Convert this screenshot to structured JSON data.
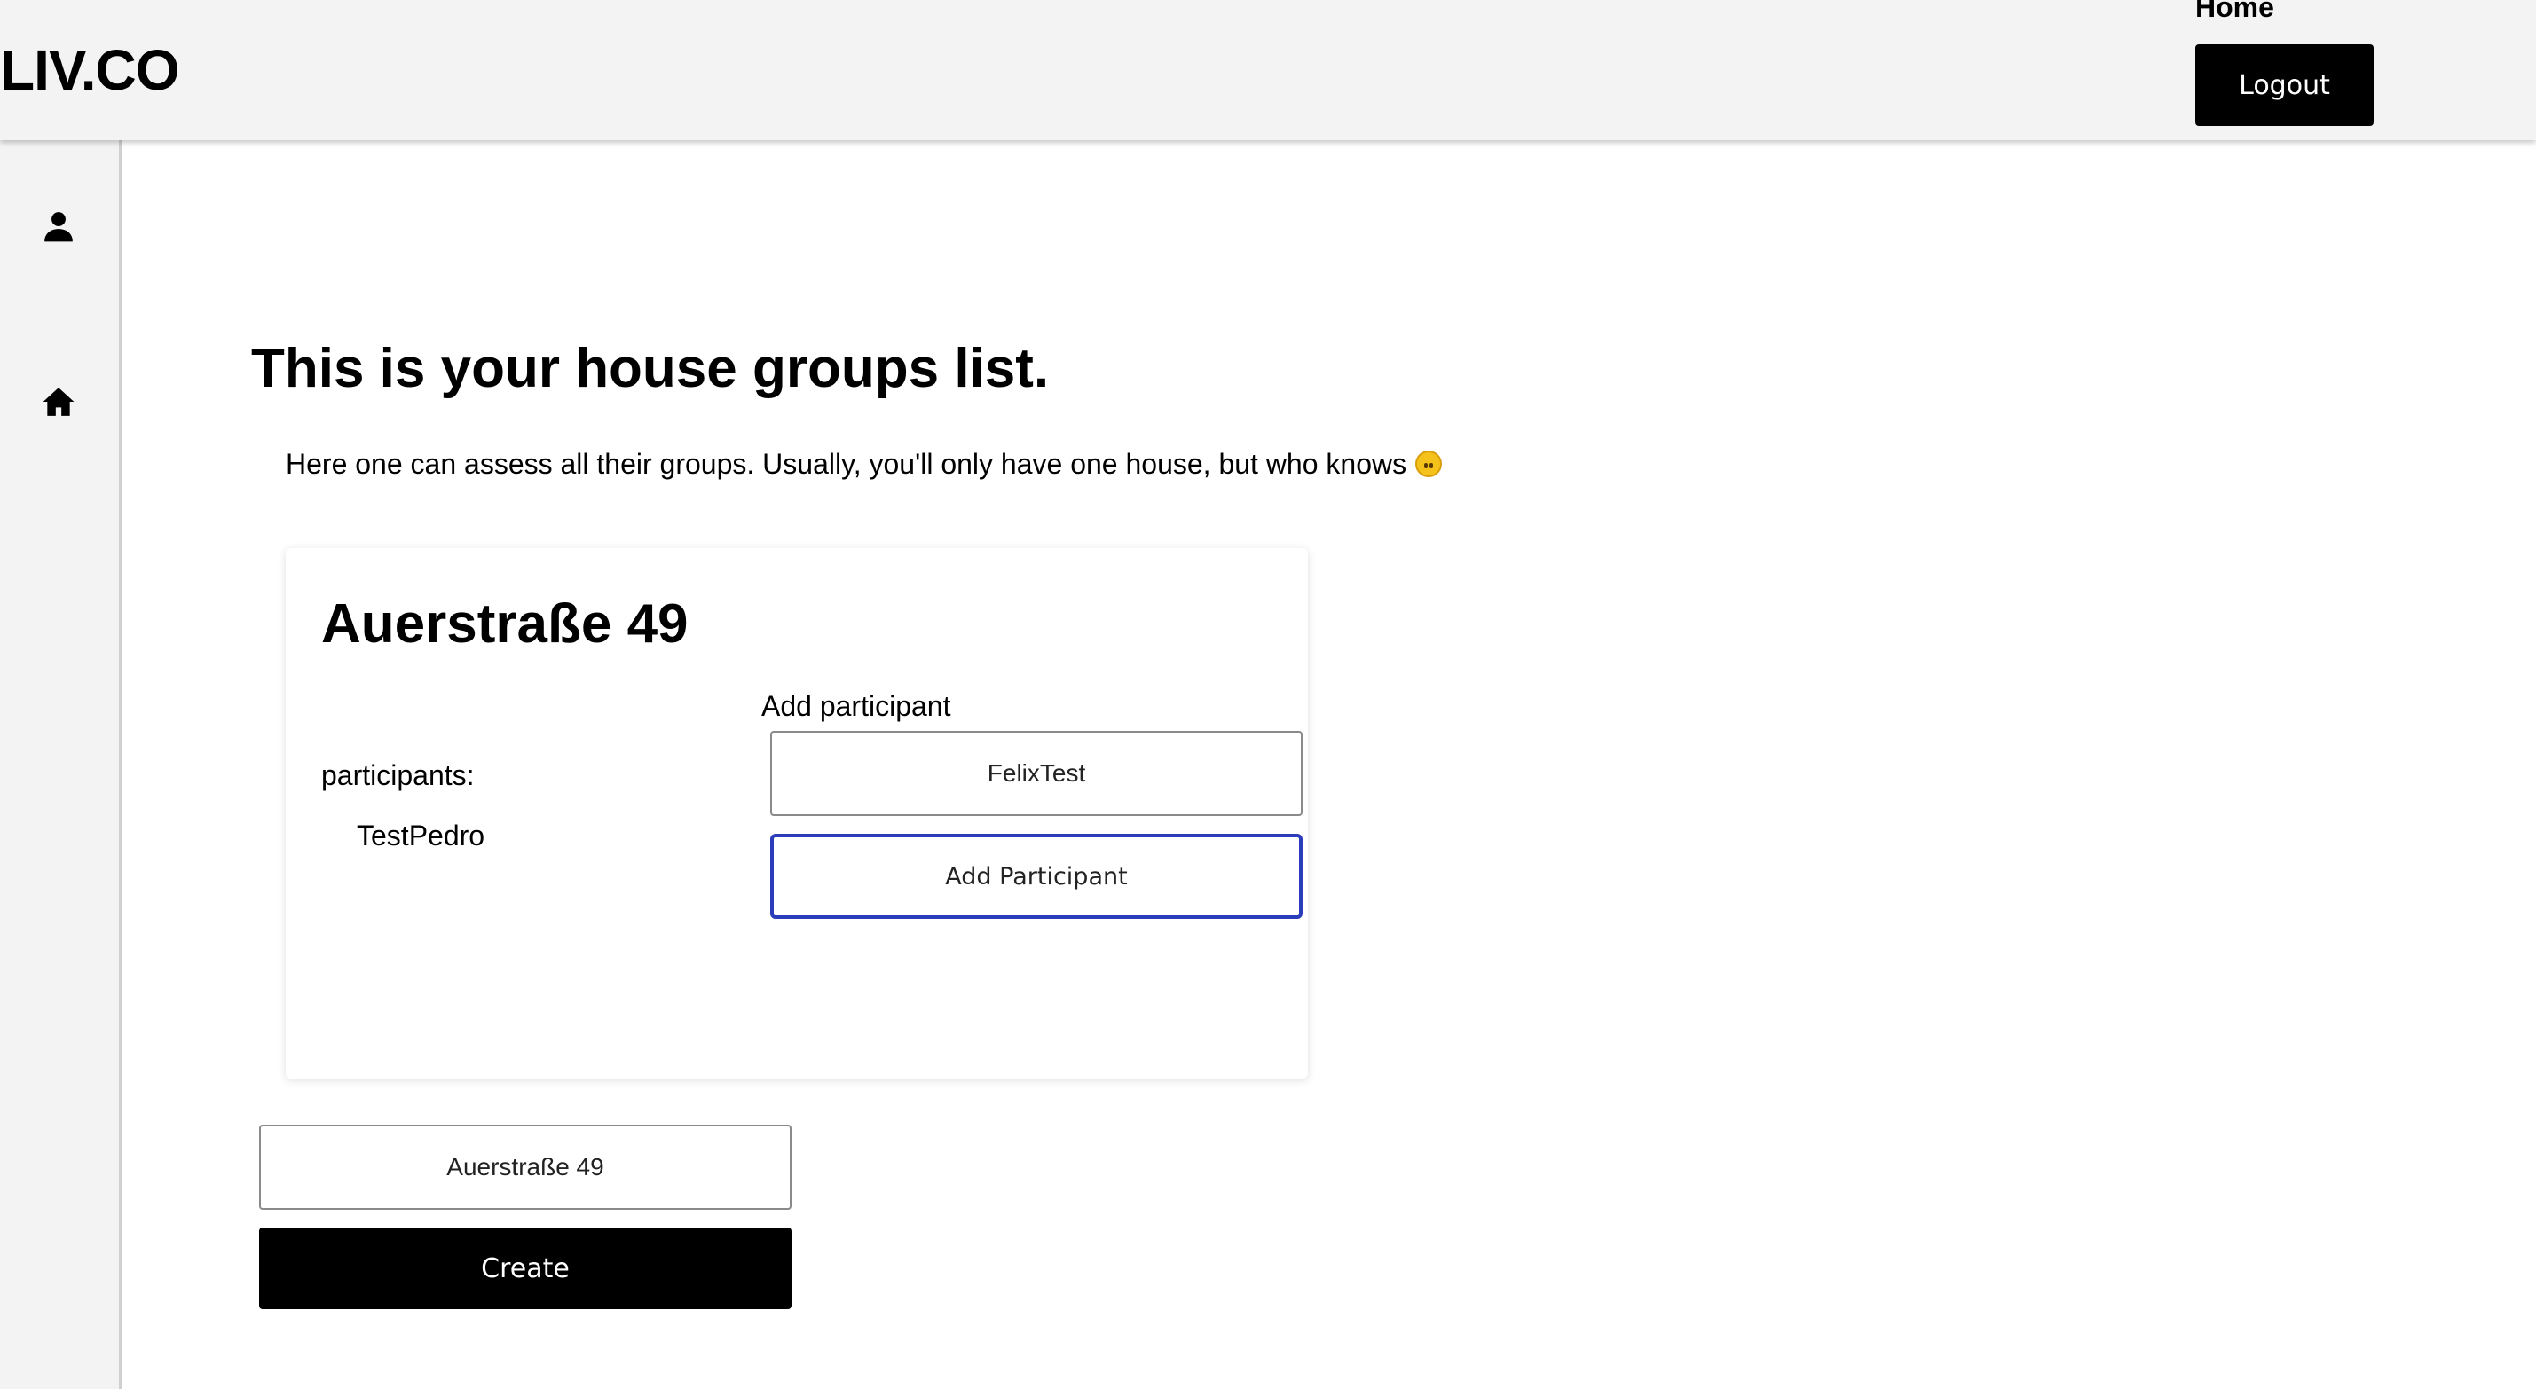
{
  "header": {
    "brand": "LIV.CO",
    "nav_home": "Home",
    "logout_label": "Logout"
  },
  "sidebar": {
    "items": [
      {
        "icon": "user-icon"
      },
      {
        "icon": "home-icon"
      }
    ]
  },
  "main": {
    "title": "This is your house groups list.",
    "subtitle": "Here one can assess all their groups. Usually, you'll only have one house, but who knows",
    "subtitle_emoji": "upside-down-face-emoji"
  },
  "groups": [
    {
      "name": "Auerstraße 49",
      "participants_label": "participants:",
      "participants": [
        "TestPedro"
      ],
      "add_participant_label": "Add participant",
      "participant_input_value": "FelixTest",
      "add_participant_button": "Add Participant"
    }
  ],
  "create_form": {
    "input_value": "Auerstraße 49",
    "create_label": "Create"
  },
  "colors": {
    "header_bg": "#f3f3f3",
    "button_bg": "#000000",
    "focus_border": "#2b3dbb"
  }
}
